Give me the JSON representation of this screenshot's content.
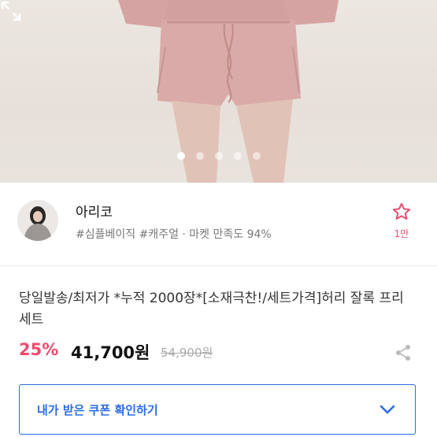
{
  "carousel": {
    "dot_count": 5,
    "active_index": 0
  },
  "seller": {
    "name": "아리코",
    "tags": "#심플베이직 #캐주얼 · 마켓 만족도 94%",
    "wishlist_count": "1만"
  },
  "product": {
    "title": "당일발송/최저가 *누적 2000장*[소재극찬!/세트가격]허리 잘록 프리 세트",
    "discount": "25%",
    "price": "41,700원",
    "original_price": "54,900원"
  },
  "coupon": {
    "label": "내가 받은 쿠폰 확인하기"
  },
  "colors": {
    "accent_pink": "#ef4a6e",
    "accent_blue": "#2a6be6",
    "pink_clothing": "#d6a5a3"
  },
  "icons": {
    "expand": "expand-icon",
    "star": "star-outline-icon",
    "share": "share-icon",
    "chevron": "chevron-down-icon"
  }
}
